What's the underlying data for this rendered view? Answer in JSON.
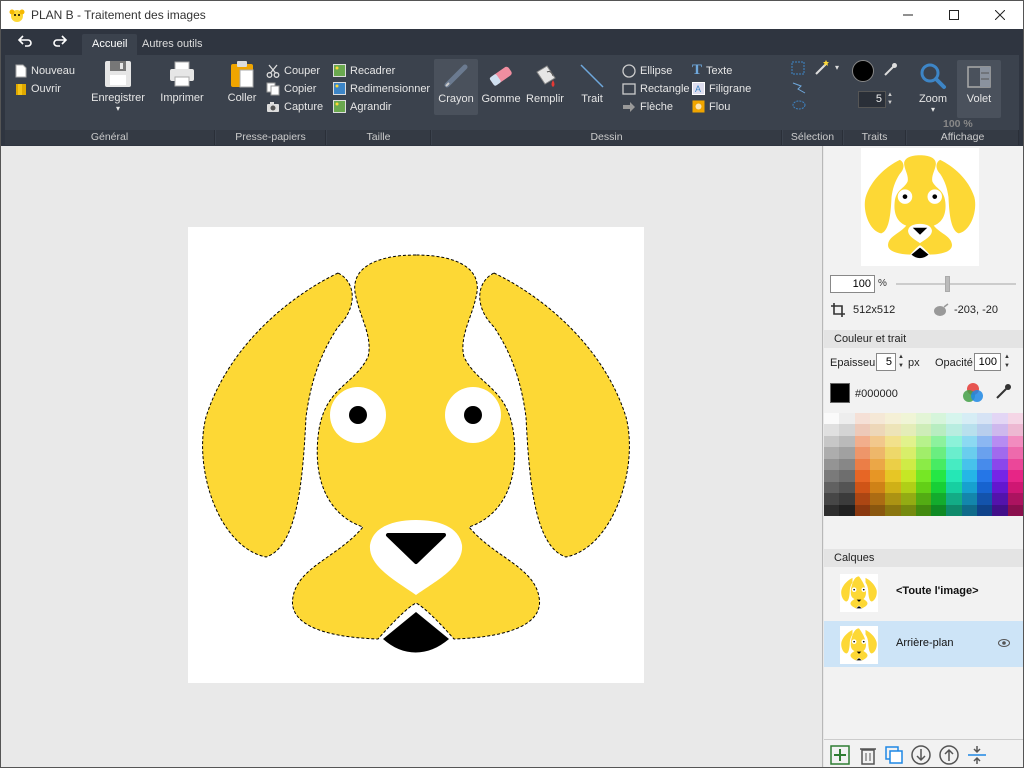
{
  "window": {
    "title": "PLAN B - Traitement des images"
  },
  "tabs": [
    {
      "label": "Accueil"
    },
    {
      "label": "Autres outils"
    }
  ],
  "groups": {
    "general": "Général",
    "clipboard": "Presse-papiers",
    "size": "Taille",
    "draw": "Dessin",
    "selection": "Sélection",
    "strokes": "Traits",
    "display": "Affichage"
  },
  "general": {
    "new": "Nouveau",
    "open": "Ouvrir",
    "save": "Enregistrer",
    "print": "Imprimer"
  },
  "clipboard": {
    "paste": "Coller",
    "cut": "Couper",
    "copy": "Copier",
    "capture": "Capture"
  },
  "size": {
    "crop": "Recadrer",
    "resize": "Redimensionner",
    "enlarge": "Agrandir"
  },
  "draw": {
    "pencil": "Crayon",
    "eraser": "Gomme",
    "fill": "Remplir",
    "line": "Trait",
    "ellipse": "Ellipse",
    "rectangle": "Rectangle",
    "arrow": "Flèche",
    "text": "Texte",
    "watermark": "Filigrane",
    "blur": "Flou"
  },
  "strokes": {
    "size": "5"
  },
  "display": {
    "zoom": "Zoom",
    "pane": "Volet",
    "zoom_value": "100 %"
  },
  "side": {
    "zoom_value": "100",
    "zoom_unit": "%",
    "dimensions": "512x512",
    "cursor": "-203, -20",
    "color_section": "Couleur et trait",
    "thickness_label": "Epaisseur",
    "thickness_value": "5",
    "thickness_unit": "px",
    "opacity_label": "Opacité",
    "opacity_value": "100",
    "color_hex": "#000000",
    "layers_section": "Calques",
    "layers": [
      {
        "name": "<Toute l'image>"
      },
      {
        "name": "Arrière-plan"
      }
    ]
  },
  "colors": {
    "ribbon": "#2f3540",
    "dog_yellow": "#fdd835",
    "selected_layer": "#cde4f7",
    "accent": "#3aa0e8"
  }
}
